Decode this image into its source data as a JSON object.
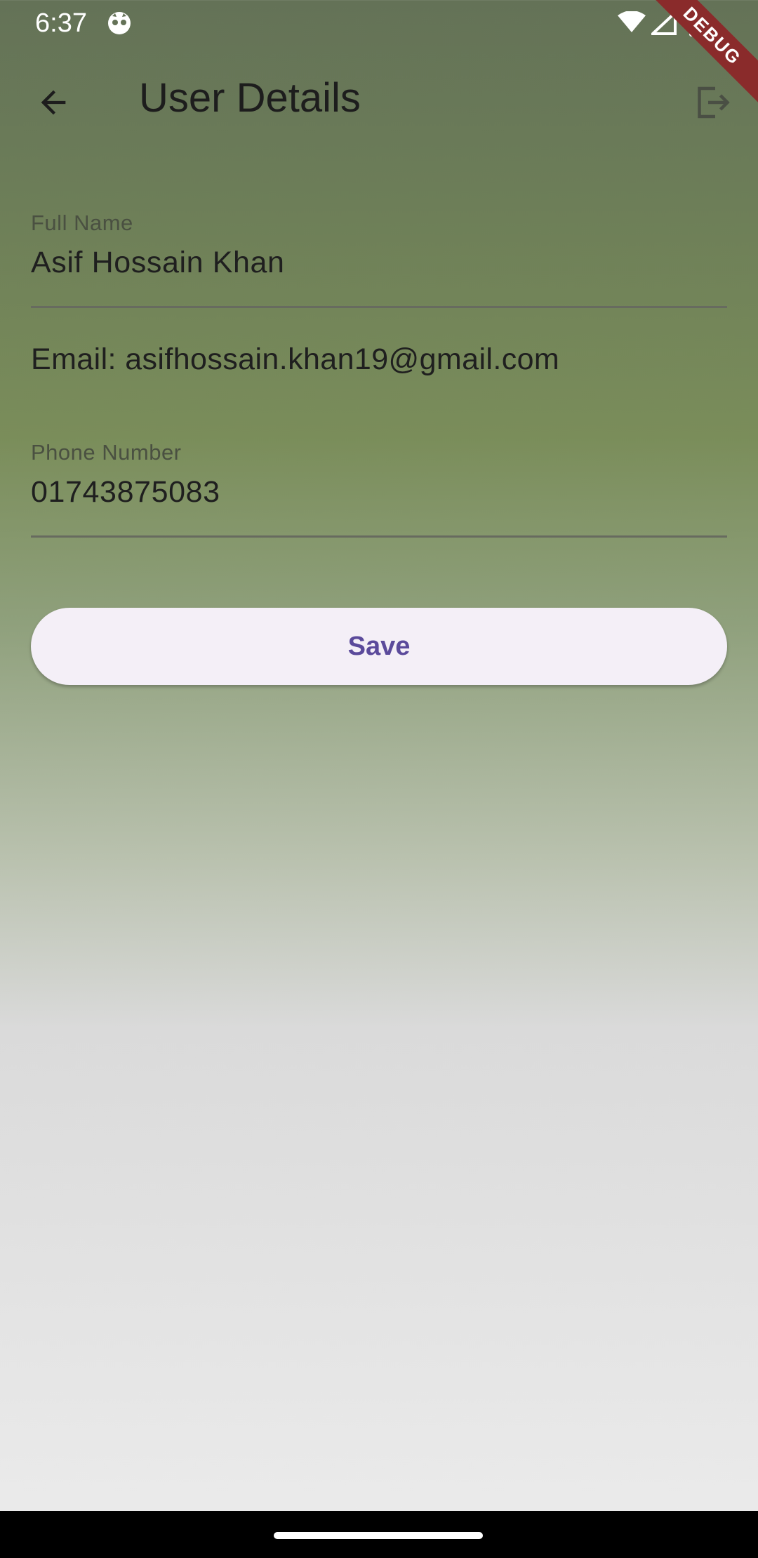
{
  "status_bar": {
    "time": "6:37",
    "icons": [
      "app-notification-icon",
      "wifi-icon",
      "signal-icon",
      "battery-icon"
    ]
  },
  "debug_banner": "DEBUG",
  "app_bar": {
    "title": "User Details",
    "back_icon": "arrow-back-icon",
    "logout_icon": "logout-icon"
  },
  "form": {
    "full_name": {
      "label": "Full Name",
      "value": "Asif Hossain Khan"
    },
    "email_text": "Email: asifhossain.khan19@gmail.com",
    "phone": {
      "label": "Phone Number",
      "value": "01743875083"
    },
    "save_label": "Save"
  },
  "colors": {
    "button_text": "#5b4a9b",
    "button_bg": "#f4eff7",
    "debug_banner": "#8a2b2b"
  }
}
